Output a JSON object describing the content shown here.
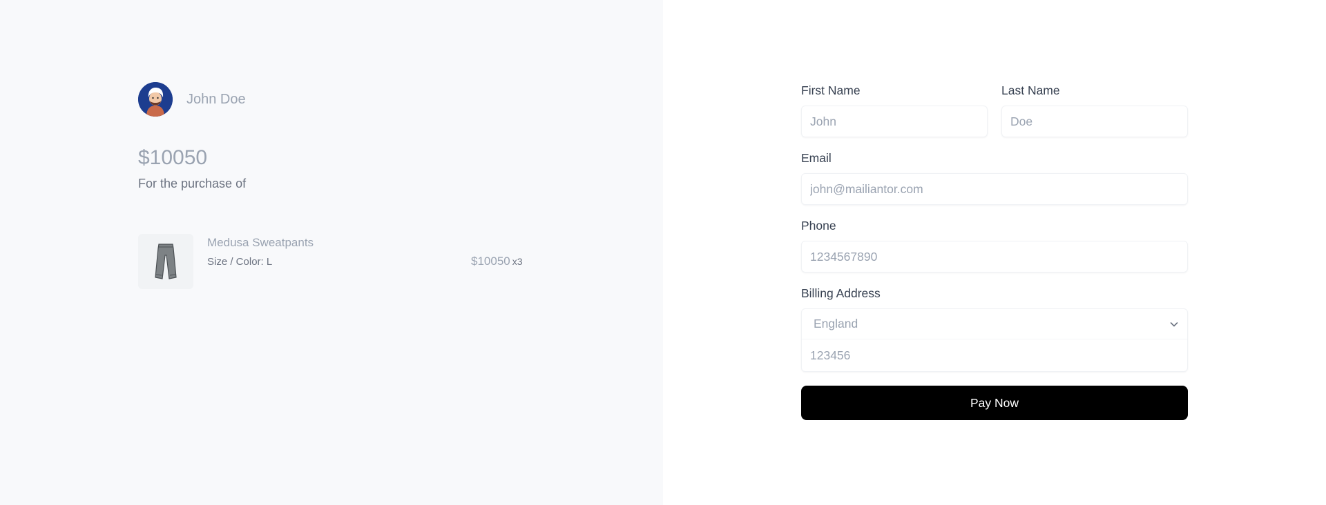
{
  "merchant": {
    "name": "John Doe",
    "avatar_icon": "avatar-icon"
  },
  "order": {
    "total": "$10050",
    "purchase_label": "For the purchase of",
    "items": [
      {
        "name": "Medusa Sweatpants",
        "variant": "Size / Color: L",
        "price": "$10050",
        "quantity": "x3",
        "thumbnail_icon": "sweatpants-icon"
      }
    ]
  },
  "form": {
    "first_name": {
      "label": "First Name",
      "placeholder": "John"
    },
    "last_name": {
      "label": "Last Name",
      "placeholder": "Doe"
    },
    "email": {
      "label": "Email",
      "placeholder": "john@mailiantor.com"
    },
    "phone": {
      "label": "Phone",
      "placeholder": "1234567890"
    },
    "billing": {
      "label": "Billing Address",
      "country": "England",
      "postal_placeholder": "123456"
    },
    "pay_label": "Pay Now"
  },
  "colors": {
    "summary_bg": "#f8f9fb",
    "muted_text": "#9aa3b1",
    "button_bg": "#000000",
    "avatar_bg": "#1d3d8f"
  }
}
